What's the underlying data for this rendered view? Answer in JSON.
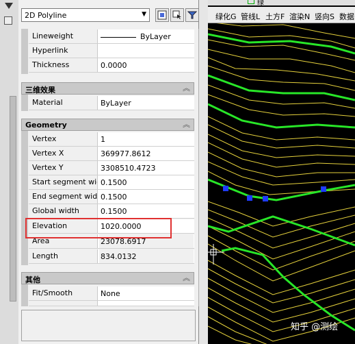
{
  "selector": {
    "value": "2D Polyline"
  },
  "toolbar": {
    "icons": [
      "select-objects-icon",
      "quick-select-icon",
      "filter-icon"
    ]
  },
  "sections": {
    "general": {
      "rows": [
        {
          "name": "Lineweight",
          "value": "ByLayer"
        },
        {
          "name": "Hyperlink",
          "value": ""
        },
        {
          "name": "Thickness",
          "value": "0.0000"
        }
      ]
    },
    "3d": {
      "title": "三维效果",
      "rows": [
        {
          "name": "Material",
          "value": "ByLayer"
        }
      ]
    },
    "geometry": {
      "title": "Geometry",
      "rows": [
        {
          "name": "Vertex",
          "value": "1"
        },
        {
          "name": "Vertex X",
          "value": "369977.8612"
        },
        {
          "name": "Vertex Y",
          "value": "3308510.4723"
        },
        {
          "name": "Start segment wid...",
          "value": "0.1500"
        },
        {
          "name": "End segment width",
          "value": "0.1500"
        },
        {
          "name": "Global width",
          "value": "0.1500"
        },
        {
          "name": "Elevation",
          "value": "1020.0000"
        },
        {
          "name": "Area",
          "value": "23078.6917"
        },
        {
          "name": "Length",
          "value": "834.0132"
        }
      ]
    },
    "misc": {
      "title": "其他",
      "rows": [
        {
          "name": "Fit/Smooth",
          "value": "None"
        }
      ]
    }
  },
  "cad_top": {
    "label": "绿"
  },
  "cad_menu": [
    "绿化G",
    "管线L",
    "土方F",
    "渲染N",
    "竖向S",
    "数据"
  ],
  "watermark": "知乎 @测绘",
  "colors": {
    "contour_yellow": "#e6d23c",
    "contour_green": "#28e628",
    "grip_blue": "#1e3cff",
    "highlight_red": "#e03030"
  }
}
